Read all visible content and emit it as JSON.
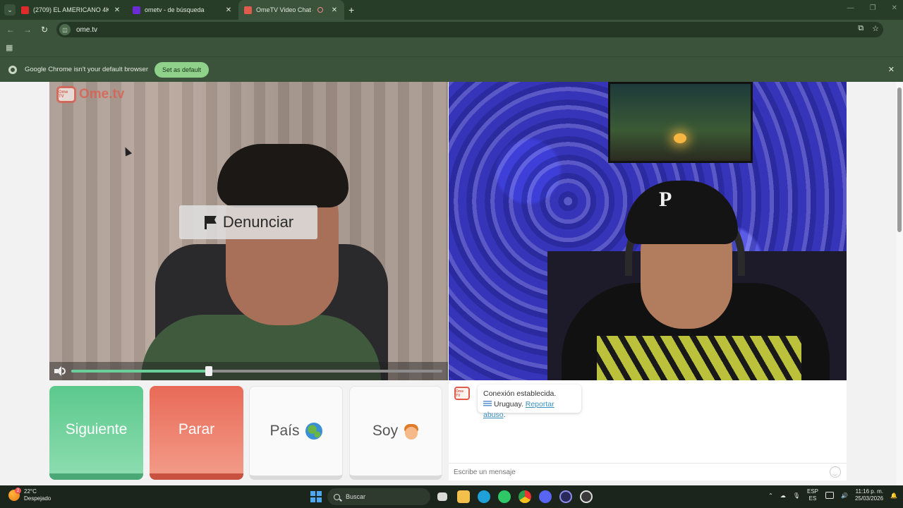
{
  "browser": {
    "tabs": [
      {
        "title": "(2709) EL AMERICANO 4KT - C...",
        "favicon_color": "#e02b2b"
      },
      {
        "title": "ometv - de búsqueda",
        "favicon_color": "#6b2bd6"
      },
      {
        "title": "OmeTV Video Chat — Ome...",
        "favicon_color": "#e05b4b"
      }
    ],
    "url": "ome.tv",
    "infobar": {
      "message": "Google Chrome isn't your default browser",
      "button": "Set as default"
    }
  },
  "video": {
    "logo_text": "Ome.tv",
    "logo_badge": "Ome TV",
    "report_button": "Denunciar",
    "volume_level": 0.37
  },
  "controls": {
    "next": "Siguiente",
    "stop": "Parar",
    "country": "País",
    "gender": "Soy"
  },
  "chat": {
    "status": "Conexión establecida.",
    "country": "Uruguay.",
    "report_link": "Reportar abuso",
    "link_suffix": ".",
    "input_placeholder": "Escribe un mensaje"
  },
  "taskbar": {
    "temperature": "22°C",
    "weather": "Despejado",
    "weather_badge": "2",
    "search_label": "Buscar",
    "lang_top": "ESP",
    "lang_bottom": "ES",
    "time": "11:16 p. m.",
    "date": "25/03/2026"
  },
  "colors": {
    "next": "#5cc98d",
    "stop": "#e86a57",
    "brand": "#e05b4b",
    "link": "#3a8fc0"
  }
}
